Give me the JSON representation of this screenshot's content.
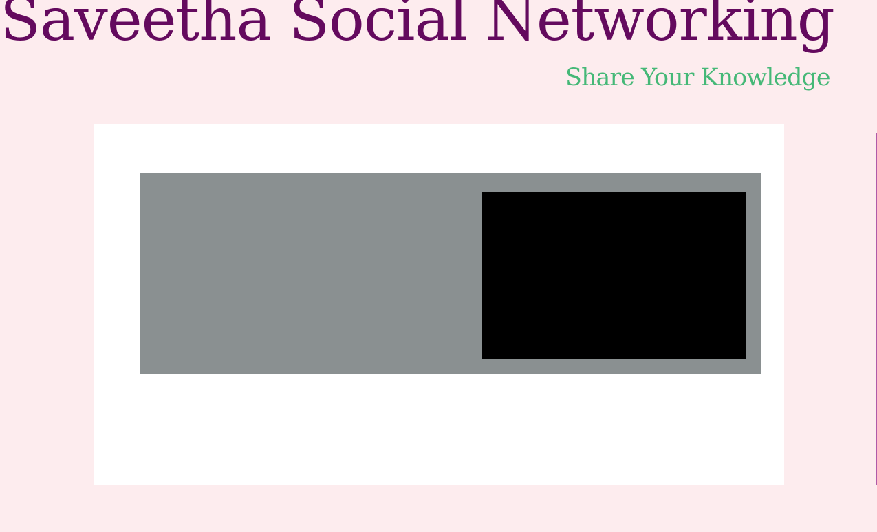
{
  "header": {
    "title": "Saveetha Social Networking",
    "tagline": "Share Your Knowledge"
  },
  "colors": {
    "page_background": "#fdecee",
    "title": "#640a5e",
    "tagline": "#45b877",
    "panel": "#ffffff",
    "media_frame": "#8a9091",
    "video": "#000000",
    "edge_line": "#b05aa8"
  }
}
